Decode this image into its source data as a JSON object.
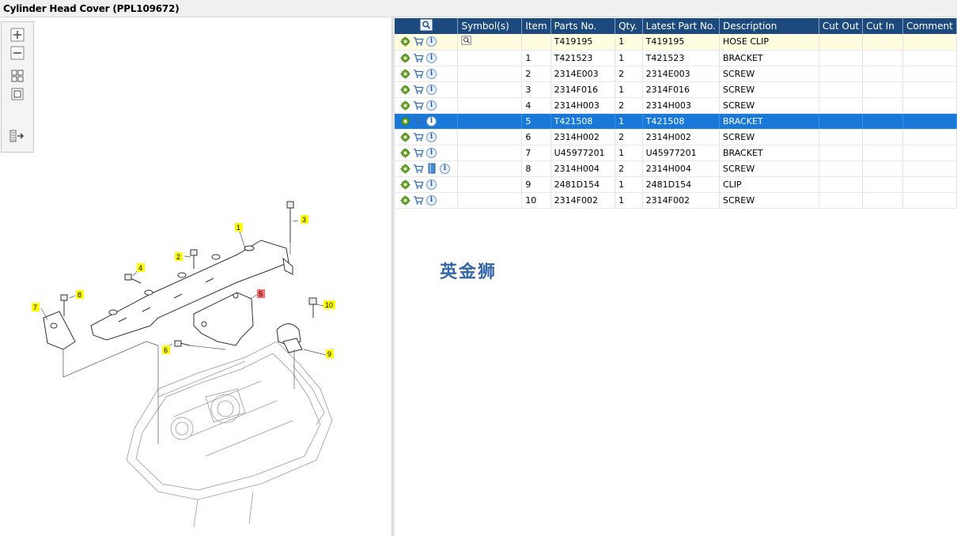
{
  "window": {
    "title": "Cylinder Head Cover (PPL109672)"
  },
  "toolbar": {
    "buttons": [
      "zoom-in-icon",
      "zoom-out-icon",
      "fit-page-icon",
      "actual-size-icon",
      "toggle-list-icon"
    ]
  },
  "diagram": {
    "callouts": [
      "1",
      "2",
      "3",
      "4",
      "5",
      "6",
      "7",
      "8",
      "9",
      "10"
    ]
  },
  "table": {
    "headers": [
      "",
      "Symbol(s)",
      "Item",
      "Parts No.",
      "Qty.",
      "Latest Part No.",
      "Description",
      "Cut Out",
      "Cut In",
      "Comment"
    ],
    "rows": [
      {
        "item": "",
        "part_no": "T419195",
        "qty": "1",
        "latest": "T419195",
        "desc": "HOSE CLIP",
        "cut_out": "",
        "cut_in": "",
        "comment": ""
      },
      {
        "item": "1",
        "part_no": "T421523",
        "qty": "1",
        "latest": "T421523",
        "desc": "BRACKET",
        "cut_out": "",
        "cut_in": "",
        "comment": ""
      },
      {
        "item": "2",
        "part_no": "2314E003",
        "qty": "2",
        "latest": "2314E003",
        "desc": "SCREW",
        "cut_out": "",
        "cut_in": "",
        "comment": ""
      },
      {
        "item": "3",
        "part_no": "2314F016",
        "qty": "1",
        "latest": "2314F016",
        "desc": "SCREW",
        "cut_out": "",
        "cut_in": "",
        "comment": ""
      },
      {
        "item": "4",
        "part_no": "2314H003",
        "qty": "2",
        "latest": "2314H003",
        "desc": "SCREW",
        "cut_out": "",
        "cut_in": "",
        "comment": ""
      },
      {
        "item": "5",
        "part_no": "T421508",
        "qty": "1",
        "latest": "T421508",
        "desc": "BRACKET",
        "cut_out": "",
        "cut_in": "",
        "comment": ""
      },
      {
        "item": "6",
        "part_no": "2314H002",
        "qty": "2",
        "latest": "2314H002",
        "desc": "SCREW",
        "cut_out": "",
        "cut_in": "",
        "comment": ""
      },
      {
        "item": "7",
        "part_no": "U45977201",
        "qty": "1",
        "latest": "U45977201",
        "desc": "BRACKET",
        "cut_out": "",
        "cut_in": "",
        "comment": ""
      },
      {
        "item": "8",
        "part_no": "2314H004",
        "qty": "2",
        "latest": "2314H004",
        "desc": "SCREW",
        "cut_out": "",
        "cut_in": "",
        "comment": ""
      },
      {
        "item": "9",
        "part_no": "2481D154",
        "qty": "1",
        "latest": "2481D154",
        "desc": "CLIP",
        "cut_out": "",
        "cut_in": "",
        "comment": ""
      },
      {
        "item": "10",
        "part_no": "2314F002",
        "qty": "1",
        "latest": "2314F002",
        "desc": "SCREW",
        "cut_out": "",
        "cut_in": "",
        "comment": ""
      }
    ]
  },
  "watermark": "英金狮",
  "colors": {
    "header": "#1c4a7e",
    "selected_row": "#1a78d8",
    "highlight_row": "#fffce0",
    "callout_yellow": "#ffff00",
    "callout_red": "#ff6b6b"
  }
}
